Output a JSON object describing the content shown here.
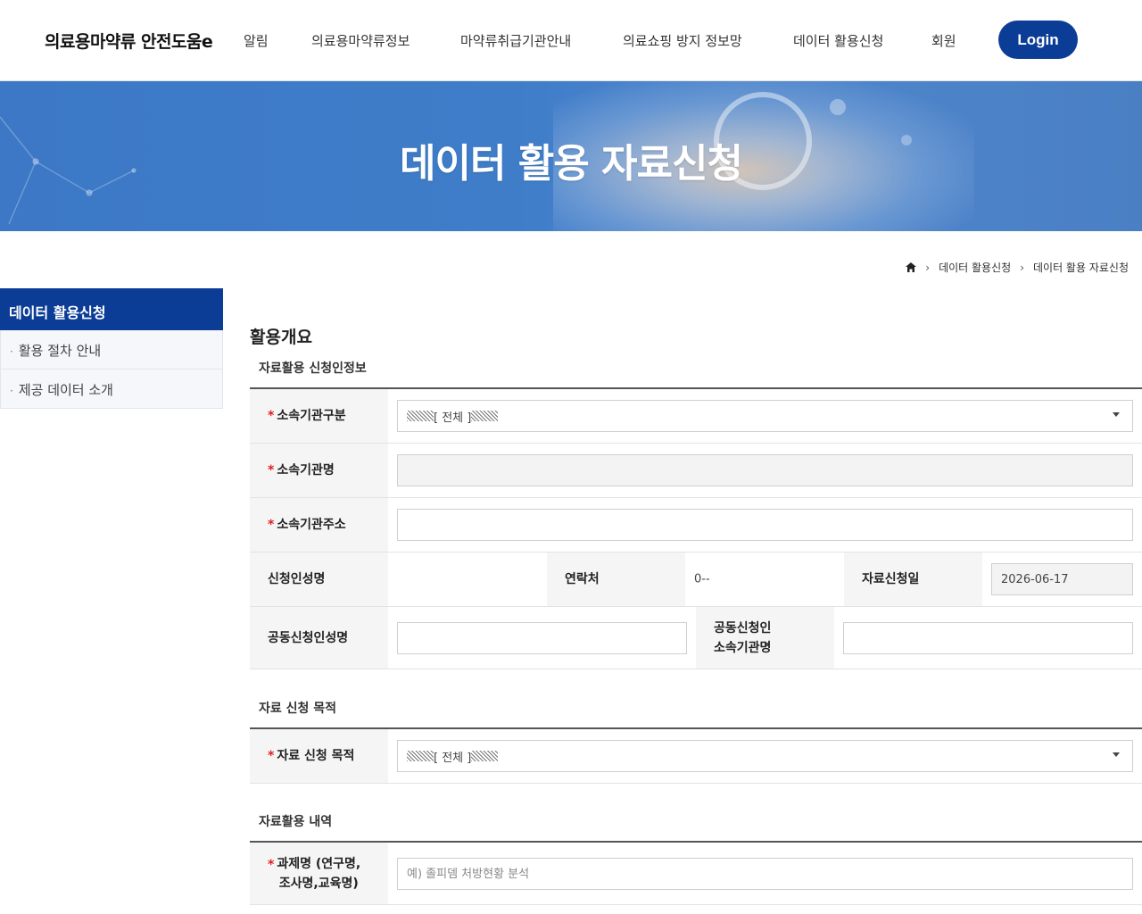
{
  "header": {
    "logo": "의료용마약류 안전도움e",
    "nav": [
      "알림",
      "의료용마약류정보",
      "마약류취급기관안내",
      "의료쇼핑 방지 정보망",
      "데이터 활용신청",
      "회원"
    ],
    "login": "Login"
  },
  "banner": {
    "title": "데이터 활용 자료신청"
  },
  "breadcrumb": {
    "items": [
      "데이터 활용신청",
      "데이터 활용 자료신청"
    ]
  },
  "sidebar": {
    "title": "데이터 활용신청",
    "items": [
      "활용 절차 안내",
      "제공 데이터 소개"
    ]
  },
  "main": {
    "page_title": "활용개요",
    "sections": {
      "applicant": "자료활용 신청인정보",
      "purpose": "자료 신청 목적",
      "details": "자료활용 내역"
    },
    "fields": {
      "org_type": {
        "label": "소속기관구분",
        "value": "[ 전체 ]"
      },
      "org_name": {
        "label": "소속기관명",
        "value": ""
      },
      "org_address": {
        "label": "소속기관주소",
        "value": ""
      },
      "applicant_name": {
        "label": "신청인성명",
        "value": ""
      },
      "contact": {
        "label": "연락처",
        "value": "0--"
      },
      "request_date": {
        "label": "자료신청일",
        "value": "2026-06-17"
      },
      "co_applicant_name": {
        "label": "공동신청인성명",
        "value": ""
      },
      "co_applicant_org": {
        "label1": "공동신청인",
        "label2": "소속기관명",
        "value": ""
      },
      "purpose": {
        "label": "자료 신청 목적",
        "value": "[ 전체 ]"
      },
      "project": {
        "label1": "과제명 (연구명,",
        "label2": "조사명,교육명)",
        "placeholder": "예) 졸피뎀 처방현황 분석"
      }
    }
  },
  "colors": {
    "primary": "#0c3d96",
    "required": "#e02020"
  }
}
